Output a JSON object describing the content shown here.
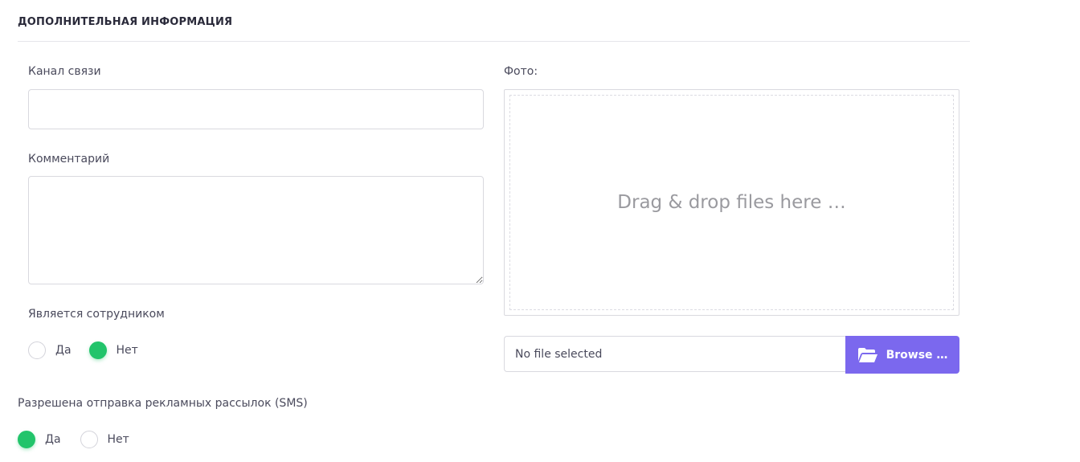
{
  "section": {
    "title": "ДОПОЛНИТЕЛЬНАЯ ИНФОРМАЦИЯ"
  },
  "contact_channel": {
    "label": "Канал связи",
    "value": "",
    "placeholder": ""
  },
  "comment": {
    "label": "Комментарий",
    "value": "",
    "placeholder": ""
  },
  "is_employee": {
    "label": "Является сотрудником",
    "options": [
      {
        "label": "Да",
        "checked": false
      },
      {
        "label": "Нет",
        "checked": true
      }
    ]
  },
  "sms_allowed": {
    "label": "Разрешена отправка рекламных рассылок (SMS)",
    "options": [
      {
        "label": "Да",
        "checked": true
      },
      {
        "label": "Нет",
        "checked": false
      }
    ]
  },
  "photo": {
    "label": "Фото:",
    "dropzone_text": "Drag & drop files here …",
    "file_status": "No file selected",
    "browse_label": "Browse …",
    "browse_icon": "folder-open-icon"
  },
  "colors": {
    "accent": "#7b68ee",
    "radio_checked": "#22c46b",
    "border": "#d9d9df"
  }
}
